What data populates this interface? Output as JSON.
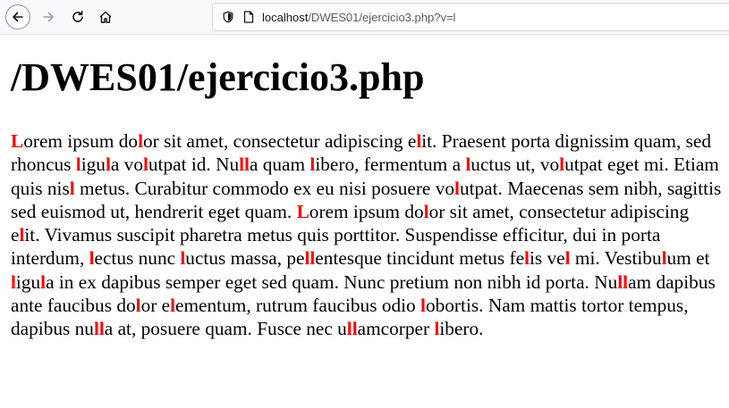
{
  "toolbar": {
    "url_host": "localhost",
    "url_path": "/DWES01/ejercicio3.php?v=l"
  },
  "page": {
    "heading": "/DWES01/ejercicio3.php",
    "highlight_letter": "l",
    "highlight_color": "#ff0000",
    "paragraph": "Lorem ipsum dolor sit amet, consectetur adipiscing elit. Praesent porta dignissim quam, sed rhoncus ligula volutpat id. Nulla quam libero, fermentum a luctus ut, volutpat eget mi. Etiam quis nisl metus. Curabitur commodo ex eu nisi posuere volutpat. Maecenas sem nibh, sagittis sed euismod ut, hendrerit eget quam. Lorem ipsum dolor sit amet, consectetur adipiscing elit. Vivamus suscipit pharetra metus quis porttitor. Suspendisse efficitur, dui in porta interdum, lectus nunc luctus massa, pellentesque tincidunt metus felis vel mi. Vestibulum et ligula in ex dapibus semper eget sed quam. Nunc pretium non nibh id porta. Nullam dapibus ante faucibus dolor elementum, rutrum faucibus odio lobortis. Nam mattis tortor tempus, dapibus nulla at, posuere quam. Fusce nec ullamcorper libero."
  }
}
